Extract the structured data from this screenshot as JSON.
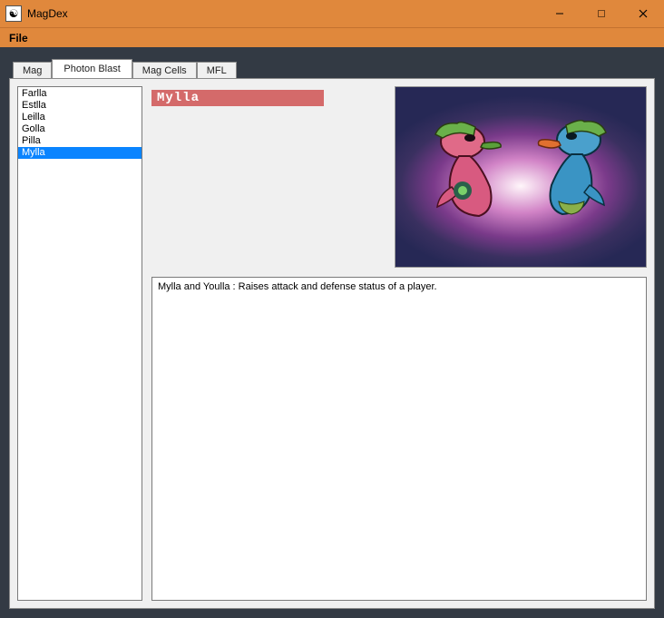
{
  "window": {
    "title": "MagDex",
    "icon_glyph": "☯"
  },
  "menu": {
    "file": "File"
  },
  "tabs": [
    {
      "label": "Mag",
      "active": false
    },
    {
      "label": "Photon Blast",
      "active": true
    },
    {
      "label": "Mag Cells",
      "active": false
    },
    {
      "label": "MFL",
      "active": false
    }
  ],
  "list": {
    "items": [
      "Farlla",
      "Estlla",
      "Leilla",
      "Golla",
      "Pilla",
      "Mylla"
    ],
    "selected_index": 5
  },
  "detail": {
    "name": "Mylla",
    "description": "Mylla and Youlla : Raises attack and defense status of a player."
  },
  "colors": {
    "titlebar": "#e0883c",
    "content_bg": "#333a44",
    "selection": "#0a84ff",
    "name_label_bg": "#d46a6a"
  }
}
